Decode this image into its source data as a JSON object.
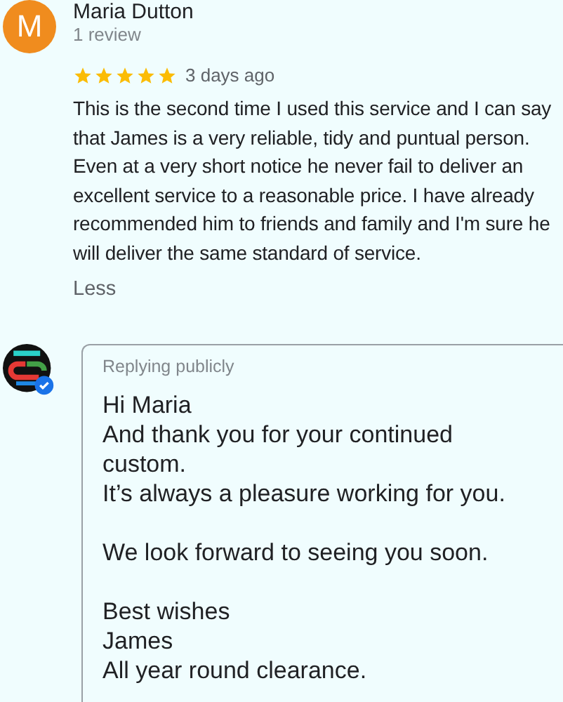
{
  "review": {
    "avatar_letter": "M",
    "author": "Maria Dutton",
    "review_count": "1 review",
    "stars": 5,
    "time": "3 days ago",
    "text": "This is the second time I used this service and I can say that James is a very reliable, tidy and puntual person. Even at a very short notice he never fail to deliver an excellent service to a reasonable price. I have already recommended him to friends and family and I'm sure he will deliver the same standard of service.",
    "toggle": "Less"
  },
  "reply": {
    "label": "Replying publicly",
    "paragraphs": [
      [
        "Hi Maria",
        "And thank you for your continued custom.",
        "It’s always a pleasure working for you."
      ],
      [
        "We look forward to seeing you soon."
      ],
      [
        "Best wishes",
        "James",
        "All year round clearance."
      ]
    ]
  }
}
